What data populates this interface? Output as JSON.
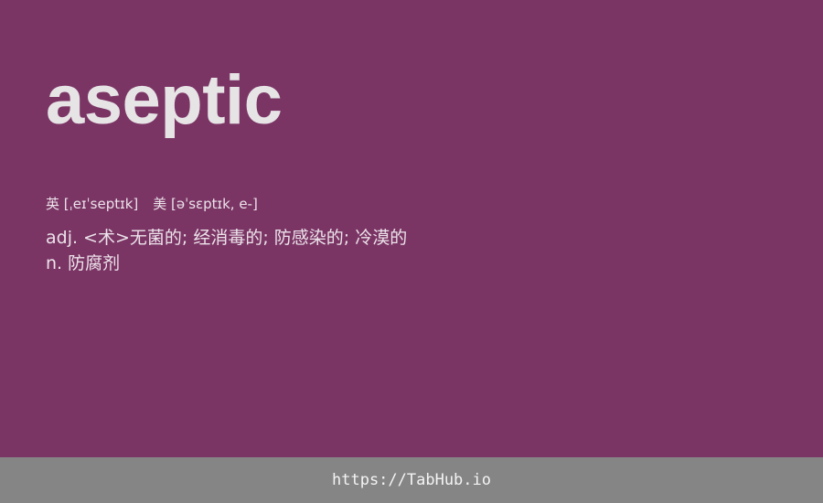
{
  "entry": {
    "word": "aseptic",
    "phonetics": {
      "uk": "英 [ˌeɪˈseptɪk]",
      "us": "美 [əˈsɛptɪk, e-]"
    },
    "definitions": [
      "adj. <术>无菌的; 经消毒的; 防感染的; 冷漠的",
      "n. 防腐剂"
    ]
  },
  "footer": {
    "link_text": "https://TabHub.io"
  },
  "colors": {
    "background": "#7b3565",
    "word": "#e7e4e6",
    "text": "#ece3ea",
    "footer_background": "#858585",
    "footer_text": "#f4f4f4"
  }
}
